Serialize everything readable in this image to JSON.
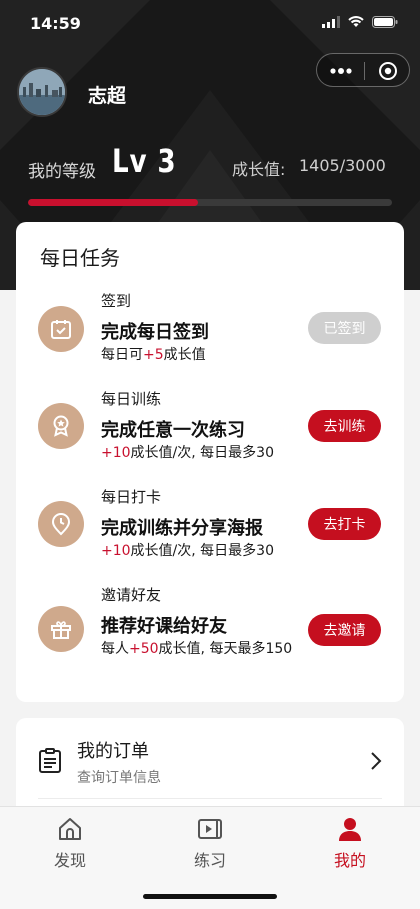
{
  "status_bar": {
    "time": "14:59"
  },
  "profile": {
    "username": "志超",
    "level_label": "我的等级",
    "level_value": "Lv 3",
    "growth_label": "成长值:",
    "growth_value": "1405/3000",
    "growth_progress": 0.468
  },
  "tasks_card": {
    "title": "每日任务",
    "tasks": [
      {
        "category": "签到",
        "title": "完成每日签到",
        "desc_prefix": "每日可",
        "desc_highlight": "+5",
        "desc_suffix": "成长值",
        "button": "已签到",
        "icon": "calendar-icon"
      },
      {
        "category": "每日训练",
        "title": "完成任意一次练习",
        "desc_prefix": "",
        "desc_highlight": "+10",
        "desc_suffix": "成长值/次, 每日最多30",
        "button": "去训练",
        "icon": "badge-icon"
      },
      {
        "category": "每日打卡",
        "title": "完成训练并分享海报",
        "desc_prefix": "",
        "desc_highlight": "+10",
        "desc_suffix": "成长值/次, 每日最多30",
        "button": "去打卡",
        "icon": "clock-pin-icon"
      },
      {
        "category": "邀请好友",
        "title": "推荐好课给好友",
        "desc_prefix": "每人",
        "desc_highlight": "+50",
        "desc_suffix": "成长值, 每天最多150",
        "button": "去邀请",
        "icon": "gift-icon"
      }
    ]
  },
  "orders": {
    "title": "我的订单",
    "subtitle": "查询订单信息"
  },
  "tabbar": {
    "tabs": [
      "发现",
      "练习",
      "我的"
    ],
    "active": "我的"
  },
  "colors": {
    "accent": "#c50f1f",
    "task_icon_bg": "#cfa98c",
    "header_bg": "#181818"
  }
}
